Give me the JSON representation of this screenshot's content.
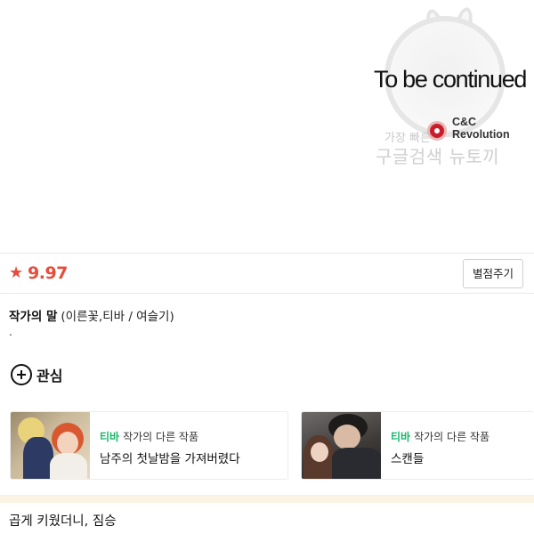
{
  "chapter_image": {
    "end_text": "To be continued",
    "logo_name": "C&C\nRevolution",
    "watermark_small": "가장 빠른",
    "watermark_big": "구글검색 뉴토끼"
  },
  "rating": {
    "star_icon": "★",
    "score": "9.97",
    "rate_button_label": "별점주기",
    "accent_color": "#e74c3c"
  },
  "author_note": {
    "label": "작가의 말",
    "authors": "(이른꽃,티바 / 여슬기)",
    "body": "."
  },
  "interest": {
    "label": "관심"
  },
  "other_works": [
    {
      "platform": "티바",
      "meta": "작가의 다른 작품",
      "title": "남주의 첫날밤을 가져버렸다"
    },
    {
      "platform": "티바",
      "meta": "작가의 다른 작품",
      "title": "스캔들"
    }
  ],
  "platform_color": "#17b86b",
  "next_series": {
    "title": "곱게 키웠더니, 짐승"
  }
}
